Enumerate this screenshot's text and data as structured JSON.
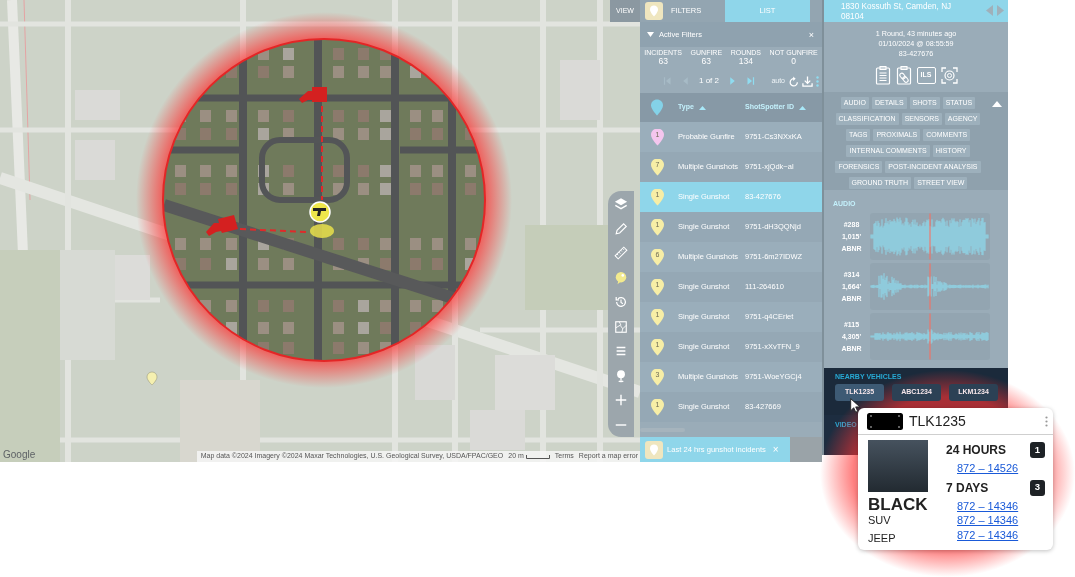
{
  "view_label": "VIEW",
  "tabs": [
    {
      "kind": "filters",
      "label": "FILTERS",
      "selected": false
    },
    {
      "kind": "list",
      "label": "LIST",
      "selected": true
    }
  ],
  "active_filters": {
    "title": "Active Filters",
    "expanded": true,
    "close": "×"
  },
  "stats": [
    {
      "label": "INCIDENTS",
      "value": "63"
    },
    {
      "label": "GUNFIRE",
      "value": "63"
    },
    {
      "label": "ROUNDS",
      "value": "134"
    },
    {
      "label": "NOT GUNFIRE",
      "value": "0"
    }
  ],
  "pagination": {
    "page": "1 of 2",
    "auto": "auto",
    "controls": [
      {
        "kind": "first",
        "disabled": true
      },
      {
        "kind": "prev",
        "disabled": true
      },
      {
        "kind": "next",
        "disabled": false
      },
      {
        "kind": "last",
        "disabled": false
      }
    ]
  },
  "columns": [
    "Type",
    "ShotSpotter ID"
  ],
  "incidents": [
    {
      "count": "1",
      "type": "Probable Gunfire",
      "id": "9751-Cs3NXxKA",
      "color": "#f4c6ee",
      "selected": false
    },
    {
      "count": "7",
      "type": "Multiple Gunshots",
      "id": "9751-xjQdk~al",
      "color": "#f7eea6",
      "selected": false
    },
    {
      "count": "1",
      "type": "Single Gunshot",
      "id": "83-427676",
      "color": "#f7eea6",
      "selected": true
    },
    {
      "count": "1",
      "type": "Single Gunshot",
      "id": "9751-dH3QQNjd",
      "color": "#f7eea6",
      "selected": false
    },
    {
      "count": "6",
      "type": "Multiple Gunshots",
      "id": "9751-6m27IDWZ",
      "color": "#f7eea6",
      "selected": false
    },
    {
      "count": "1",
      "type": "Single Gunshot",
      "id": "111-264610",
      "color": "#f7eea6",
      "selected": false
    },
    {
      "count": "1",
      "type": "Single Gunshot",
      "id": "9751-q4CEriet",
      "color": "#f7eea6",
      "selected": false
    },
    {
      "count": "1",
      "type": "Single Gunshot",
      "id": "9751-xXvTFN_9",
      "color": "#f7eea6",
      "selected": false
    },
    {
      "count": "3",
      "type": "Multiple Gunshots",
      "id": "9751-WoeYGCj4",
      "color": "#f7eea6",
      "selected": false
    },
    {
      "count": "1",
      "type": "Single Gunshot",
      "id": "83-427669",
      "color": "#f7eea6",
      "selected": false
    }
  ],
  "filter_chip": {
    "label": "Last 24 hrs gunshot incidents",
    "close": "×"
  },
  "map": {
    "logo": "Google",
    "attribution": "Map data ©2024 Imagery ©2024 Maxar Technologies, U.S. Geological Survey, USDA/FPAC/GEO",
    "scale": "20 m",
    "terms": "Terms",
    "report": "Report a map error"
  },
  "map_tools": [
    {
      "kind": "layers",
      "selected": false
    },
    {
      "kind": "draw",
      "selected": false
    },
    {
      "kind": "measure",
      "selected": false
    },
    {
      "kind": "incidents",
      "selected": true
    },
    {
      "kind": "history",
      "selected": false
    },
    {
      "kind": "area",
      "selected": false
    },
    {
      "kind": "list",
      "selected": false
    },
    {
      "kind": "pin",
      "selected": false
    },
    {
      "kind": "zoom_in",
      "selected": false
    },
    {
      "kind": "zoom_out",
      "selected": false
    }
  ],
  "incident_detail": {
    "address": "1830 Kossuth St, Camden, NJ 08104",
    "summary": "1 Round, 43 minutes ago",
    "timestamp": "01/10/2024 @ 08:55:59",
    "id": "83-427676",
    "ils_label": "ILS"
  },
  "section_buttons": [
    [
      "AUDIO",
      "DETAILS",
      "SHOTS",
      "STATUS"
    ],
    [
      "CLASSIFICATION",
      "SENSORS",
      "AGENCY"
    ],
    [
      "TAGS",
      "PROXIMALS",
      "COMMENTS"
    ],
    [
      "INTERNAL COMMENTS",
      "HISTORY"
    ],
    [
      "FORENSICS",
      "POST-INCIDENT ANALYSIS"
    ],
    [
      "GROUND TRUTH",
      "STREET VIEW"
    ]
  ],
  "audio": {
    "title": "AUDIO",
    "clips": [
      {
        "sensor": "#288",
        "distance": "1,015'",
        "tag": "ABNR"
      },
      {
        "sensor": "#314",
        "distance": "1,664'",
        "tag": "ABNR"
      },
      {
        "sensor": "#115",
        "distance": "4,305'",
        "tag": "ABNR"
      }
    ]
  },
  "nearby_vehicles": {
    "title": "NEARBY VEHICLES",
    "plates": [
      {
        "plate": "TLK1235",
        "selected": true
      },
      {
        "plate": "ABC1234",
        "selected": false
      },
      {
        "plate": "LKM1234",
        "selected": false
      }
    ]
  },
  "video": {
    "title": "VIDEO"
  },
  "vehicle_popup": {
    "plate": "TLK1235",
    "vehicle_color": "BLACK",
    "body_type": "SUV",
    "make": "JEEP",
    "periods": [
      {
        "label": "24 HOURS",
        "count": "1",
        "links": [
          "872 – 14526"
        ]
      },
      {
        "label": "7 DAYS",
        "count": "3",
        "links": [
          "872 – 14346",
          "872 – 14346",
          "872 – 14346"
        ]
      }
    ]
  }
}
